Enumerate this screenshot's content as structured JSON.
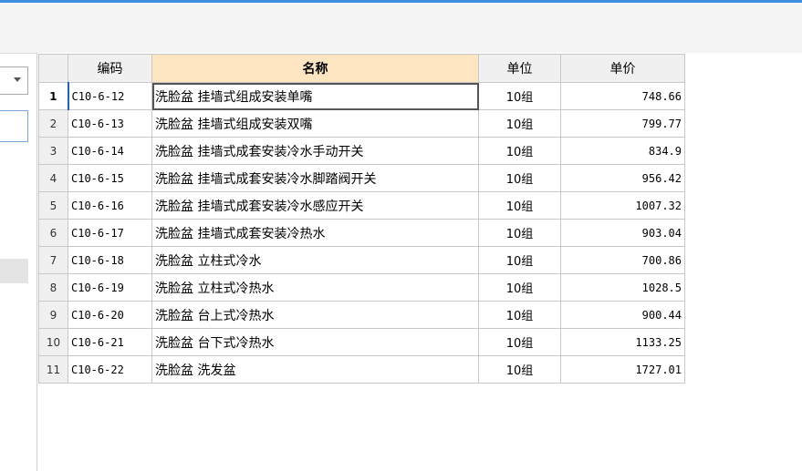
{
  "table": {
    "headers": {
      "code": "编码",
      "name": "名称",
      "unit": "单位",
      "price": "单价"
    },
    "rows": [
      {
        "index": "1",
        "code": "C10-6-12",
        "name": "洗脸盆 挂墙式组成安装单嘴",
        "unit": "10组",
        "price": "748.66"
      },
      {
        "index": "2",
        "code": "C10-6-13",
        "name": "洗脸盆 挂墙式组成安装双嘴",
        "unit": "10组",
        "price": "799.77"
      },
      {
        "index": "3",
        "code": "C10-6-14",
        "name": "洗脸盆 挂墙式成套安装冷水手动开关",
        "unit": "10组",
        "price": "834.9"
      },
      {
        "index": "4",
        "code": "C10-6-15",
        "name": "洗脸盆 挂墙式成套安装冷水脚踏阀开关",
        "unit": "10组",
        "price": "956.42"
      },
      {
        "index": "5",
        "code": "C10-6-16",
        "name": "洗脸盆 挂墙式成套安装冷水感应开关",
        "unit": "10组",
        "price": "1007.32"
      },
      {
        "index": "6",
        "code": "C10-6-17",
        "name": "洗脸盆 挂墙式成套安装冷热水",
        "unit": "10组",
        "price": "903.04"
      },
      {
        "index": "7",
        "code": "C10-6-18",
        "name": "洗脸盆 立柱式冷水",
        "unit": "10组",
        "price": "700.86"
      },
      {
        "index": "8",
        "code": "C10-6-19",
        "name": "洗脸盆 立柱式冷热水",
        "unit": "10组",
        "price": "1028.5"
      },
      {
        "index": "9",
        "code": "C10-6-20",
        "name": "洗脸盆 台上式冷热水",
        "unit": "10组",
        "price": "900.44"
      },
      {
        "index": "10",
        "code": "C10-6-21",
        "name": "洗脸盆 台下式冷热水",
        "unit": "10组",
        "price": "1133.25"
      },
      {
        "index": "11",
        "code": "C10-6-22",
        "name": "洗脸盆 洗发盆",
        "unit": "10组",
        "price": "1727.01"
      }
    ]
  },
  "selected_row": 0,
  "colors": {
    "accent": "#3d8fe0",
    "header_highlight": "#fde5c2"
  },
  "icons": {
    "dropdown": "chevron-down-icon"
  }
}
